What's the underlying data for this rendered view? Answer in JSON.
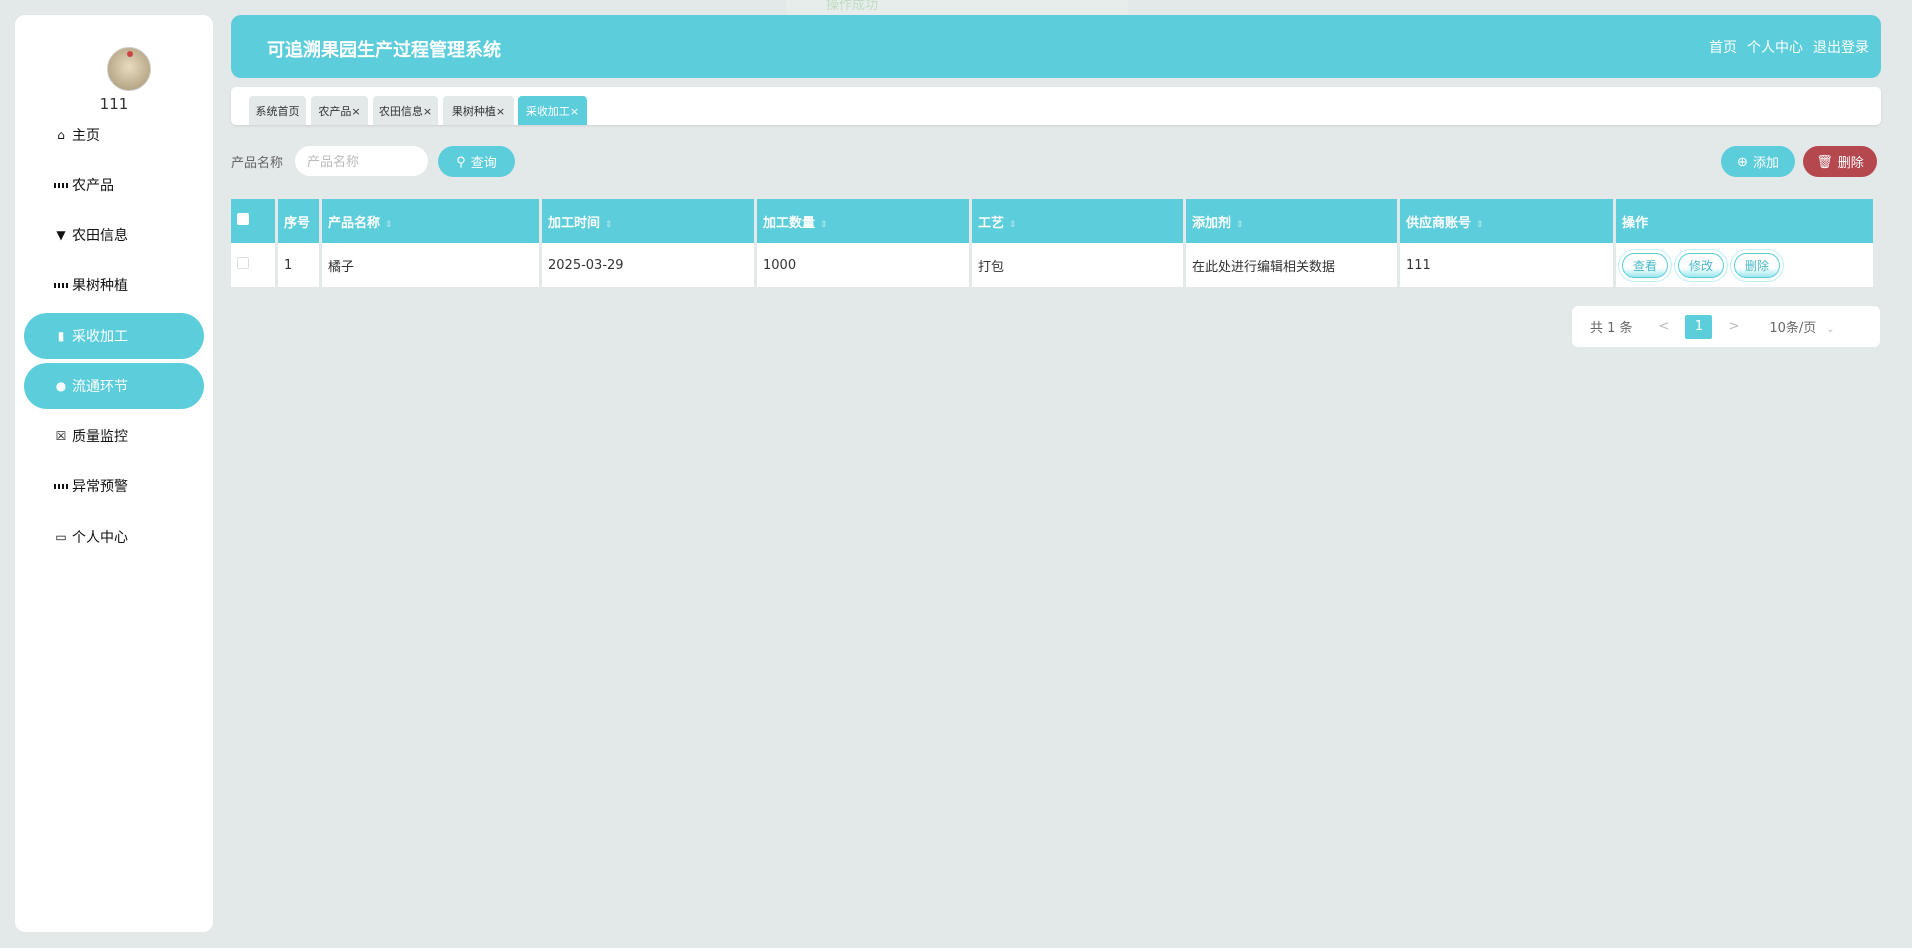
{
  "toast": "操作成功",
  "user": {
    "name": "111"
  },
  "sidebar": {
    "items": [
      {
        "label": "主页",
        "icon": "home-icon"
      },
      {
        "label": "农产品",
        "icon": "grid-icon"
      },
      {
        "label": "农田信息",
        "icon": "plug-icon"
      },
      {
        "label": "果树种植",
        "icon": "grid-icon"
      },
      {
        "label": "采收加工",
        "icon": "book-icon",
        "active": true
      },
      {
        "label": "流通环节",
        "icon": "user-icon",
        "active": true
      },
      {
        "label": "质量监控",
        "icon": "clipboard-x-icon"
      },
      {
        "label": "异常预警",
        "icon": "grid-icon"
      },
      {
        "label": "个人中心",
        "icon": "wallet-icon"
      }
    ]
  },
  "header": {
    "title": "可追溯果园生产过程管理系统",
    "links": [
      "首页",
      "个人中心",
      "退出登录"
    ]
  },
  "tabs": [
    {
      "label": "系统首页"
    },
    {
      "label": "农产品×"
    },
    {
      "label": "农田信息×"
    },
    {
      "label": "果树种植×"
    },
    {
      "label": "采收加工×",
      "active": true
    }
  ],
  "search": {
    "label": "产品名称",
    "placeholder": "产品名称",
    "button": "查询"
  },
  "toolbar": {
    "add": "添加",
    "delete": "删除"
  },
  "table": {
    "headers": [
      "序号",
      "产品名称",
      "加工时间",
      "加工数量",
      "工艺",
      "添加剂",
      "供应商账号",
      "操作"
    ],
    "rows": [
      {
        "cells": [
          "1",
          "橘子",
          "2025-03-29",
          "1000",
          "打包",
          "在此处进行编辑相关数据",
          "111"
        ],
        "actions": [
          "查看",
          "修改",
          "删除"
        ]
      }
    ]
  },
  "pagination": {
    "total": "共 1 条",
    "prev": "<",
    "current": "1",
    "next": ">",
    "page_size": "10条/页"
  },
  "colors": {
    "accent": "#5bcddb",
    "danger": "#b5474f",
    "background": "#e3e8e8"
  }
}
